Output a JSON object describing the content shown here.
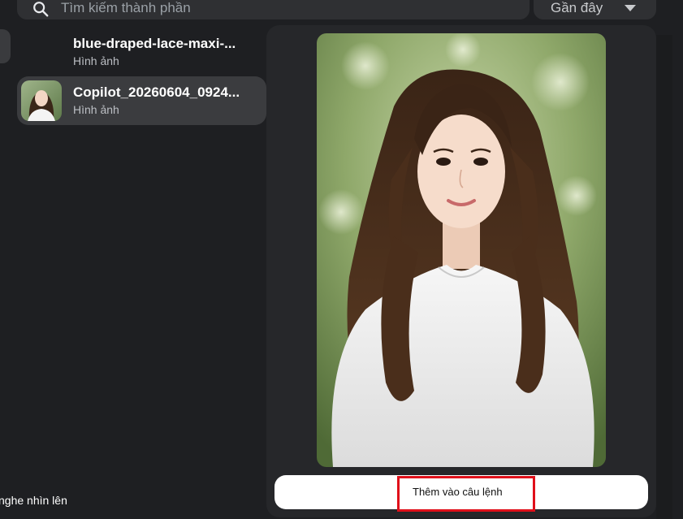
{
  "search": {
    "placeholder": "Tìm kiếm thành phần",
    "icon": "search-icon"
  },
  "sort": {
    "selected": "Gần đây",
    "icon": "chevron-down-icon"
  },
  "list": {
    "items": [
      {
        "title": "blue-draped-lace-maxi-...",
        "subtitle": "Hình ảnh",
        "selected": false
      },
      {
        "title": "Copilot_20260604_0924...",
        "subtitle": "Hình ảnh",
        "selected": true
      }
    ]
  },
  "footer": {
    "partial_text": "nghe nhìn lên"
  },
  "preview": {
    "add_button_label": "Thêm vào câu lệnh"
  },
  "colors": {
    "background": "#1e1f22",
    "panel": "#26272a",
    "selected_item": "#3b3c3f",
    "highlight": "#e0101a"
  }
}
